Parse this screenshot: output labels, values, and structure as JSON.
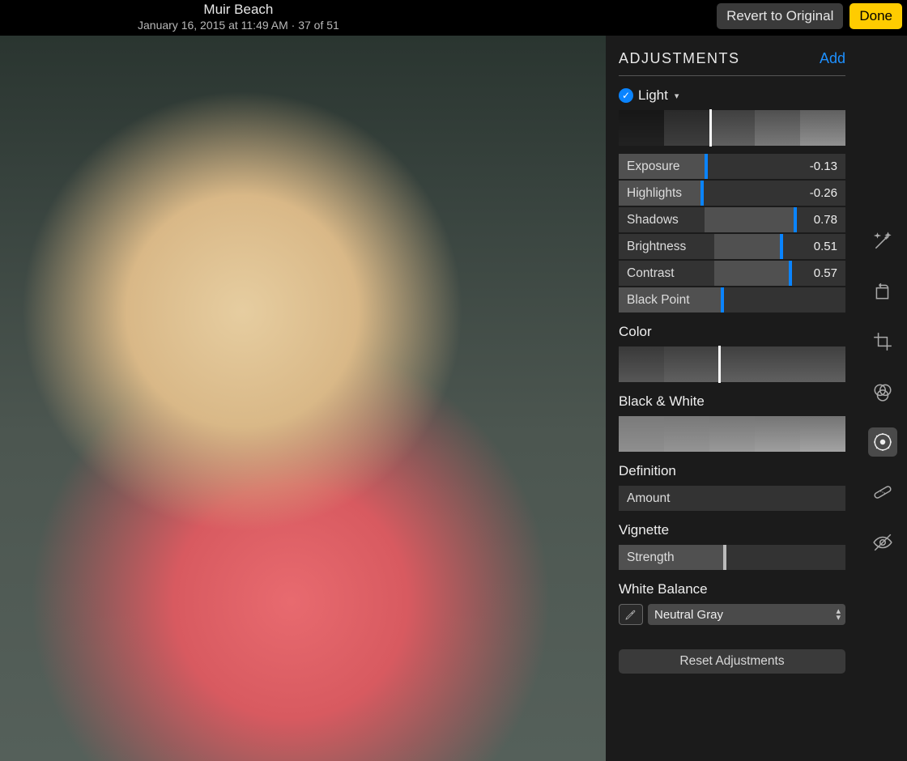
{
  "header": {
    "title": "Muir Beach",
    "meta": "January 16, 2015 at 11:49 AM  ·  37 of 51",
    "revert_label": "Revert to Original",
    "done_label": "Done"
  },
  "panel": {
    "title": "ADJUSTMENTS",
    "add_label": "Add",
    "light": {
      "label": "Light",
      "sliders": {
        "exposure": {
          "label": "Exposure",
          "value": "-0.13",
          "pos": 38
        },
        "highlights": {
          "label": "Highlights",
          "value": "-0.26",
          "pos": 36
        },
        "shadows": {
          "label": "Shadows",
          "value": "0.78",
          "pos": 77
        },
        "brightness": {
          "label": "Brightness",
          "value": "0.51",
          "pos": 71
        },
        "contrast": {
          "label": "Contrast",
          "value": "0.57",
          "pos": 75
        },
        "blackpoint": {
          "label": "Black Point",
          "value": "",
          "pos": 45
        }
      }
    },
    "color": {
      "label": "Color"
    },
    "bw": {
      "label": "Black & White"
    },
    "definition": {
      "label": "Definition",
      "slider_label": "Amount"
    },
    "vignette": {
      "label": "Vignette",
      "slider_label": "Strength",
      "pos": 46
    },
    "whitebalance": {
      "label": "White Balance",
      "selected": "Neutral Gray"
    },
    "reset_label": "Reset Adjustments"
  },
  "tools": {
    "magic": "magic-wand-icon",
    "rotate": "rotate-icon",
    "crop": "crop-icon",
    "filters": "filters-icon",
    "adjust": "adjust-icon",
    "retouch": "retouch-icon",
    "redeye": "redeye-icon"
  }
}
